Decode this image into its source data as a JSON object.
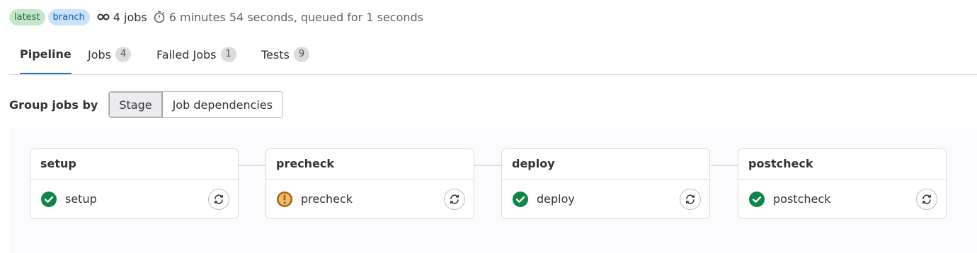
{
  "header": {
    "badges": [
      "latest",
      "branch"
    ],
    "jobs_summary": "4 jobs",
    "duration": "6 minutes 54 seconds, queued for 1 seconds"
  },
  "tabs": [
    {
      "label": "Pipeline",
      "count": null,
      "active": true
    },
    {
      "label": "Jobs",
      "count": "4"
    },
    {
      "label": "Failed Jobs",
      "count": "1"
    },
    {
      "label": "Tests",
      "count": "9"
    }
  ],
  "grouping": {
    "label": "Group jobs by",
    "options": [
      "Stage",
      "Job dependencies"
    ],
    "selected": "Stage"
  },
  "stages": [
    {
      "name": "setup",
      "jobs": [
        {
          "name": "setup",
          "status": "success"
        }
      ]
    },
    {
      "name": "precheck",
      "jobs": [
        {
          "name": "precheck",
          "status": "warning"
        }
      ]
    },
    {
      "name": "deploy",
      "jobs": [
        {
          "name": "deploy",
          "status": "success"
        }
      ]
    },
    {
      "name": "postcheck",
      "jobs": [
        {
          "name": "postcheck",
          "status": "success"
        }
      ]
    }
  ],
  "colors": {
    "success": "#108548",
    "warning": "#ab6100",
    "accent": "#1f75cb"
  },
  "icons": {
    "jobs": "pipeline-link-icon",
    "duration": "timer-icon",
    "retry": "retry-icon"
  }
}
